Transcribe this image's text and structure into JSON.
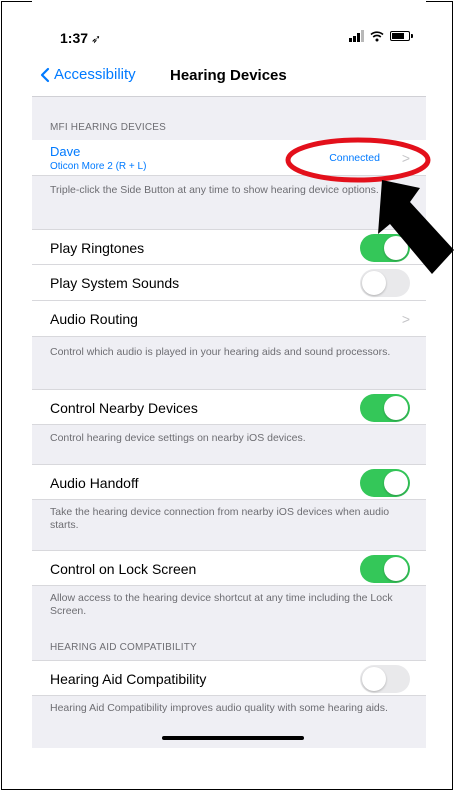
{
  "status_bar": {
    "time": "1:37"
  },
  "nav": {
    "back_label": "Accessibility",
    "title": "Hearing Devices"
  },
  "mfi": {
    "header": "MFI HEARING DEVICES",
    "device_name": "Dave",
    "device_model": "Oticon More 2 (R + L)",
    "device_status": "Connected",
    "footer": "Triple-click the Side Button at any time to show hearing device options."
  },
  "settings": {
    "play_ringtones": {
      "label": "Play Ringtones",
      "on": true
    },
    "play_system_sounds": {
      "label": "Play System Sounds",
      "on": false
    },
    "audio_routing": {
      "label": "Audio Routing",
      "footer": "Control which audio is played in your hearing aids and sound processors."
    },
    "control_nearby": {
      "label": "Control Nearby Devices",
      "on": true,
      "footer": "Control hearing device settings on nearby iOS devices."
    },
    "audio_handoff": {
      "label": "Audio Handoff",
      "on": true,
      "footer": "Take the hearing device connection from nearby iOS devices when audio starts."
    },
    "lock_screen": {
      "label": "Control on Lock Screen",
      "on": true,
      "footer": "Allow access to the hearing device shortcut at any time including the Lock Screen."
    }
  },
  "hac": {
    "header": "HEARING AID COMPATIBILITY",
    "label": "Hearing Aid Compatibility",
    "on": false,
    "footer": "Hearing Aid Compatibility improves audio quality with some hearing aids."
  },
  "colors": {
    "accent": "#007aff",
    "toggle_on": "#34c759",
    "toggle_off": "#e9e9eb",
    "annotation_red": "#e3101b",
    "group_background": "#efeff4"
  },
  "icons": {
    "back": "chevron-left-icon",
    "chevron": "chevron-right-icon",
    "location": "location-arrow-icon",
    "signal": "cellular-signal-icon",
    "wifi": "wifi-icon",
    "battery": "battery-icon",
    "annotation_arrow": "pointer-arrow-icon",
    "annotation_ellipse": "highlight-ellipse"
  }
}
